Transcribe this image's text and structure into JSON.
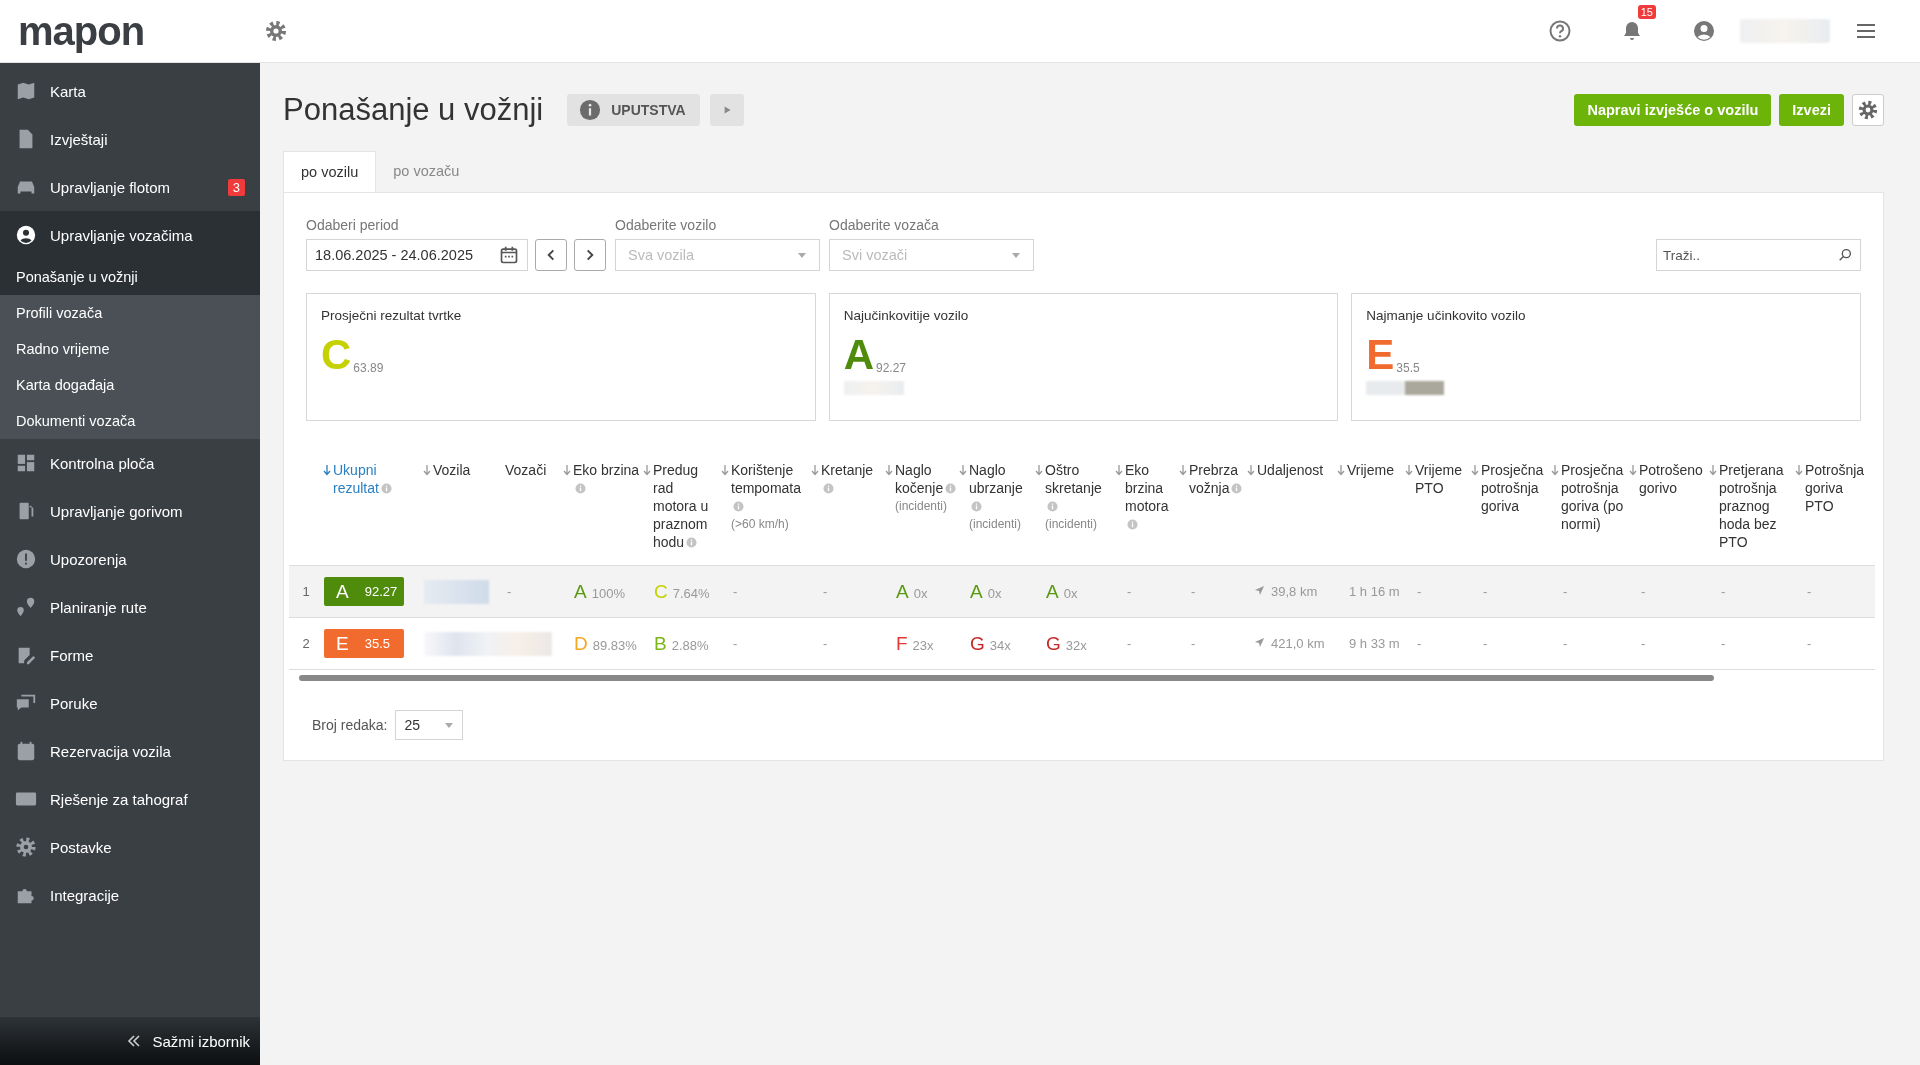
{
  "header": {
    "logo": "mapon",
    "notifications": "15"
  },
  "sidebar": {
    "items": [
      {
        "label": "Karta",
        "expanded": false
      },
      {
        "label": "Izvještaji",
        "expanded": false
      },
      {
        "label": "Upravljanje flotom",
        "badge": "3",
        "expanded": false
      },
      {
        "label": "Upravljanje vozačima",
        "expanded": true,
        "children": [
          {
            "label": "Ponašanje u vožnji",
            "selected": true
          },
          {
            "label": "Profili vozača",
            "selected": false
          },
          {
            "label": "Radno vrijeme",
            "selected": false
          },
          {
            "label": "Karta događaja",
            "selected": false
          },
          {
            "label": "Dokumenti vozača",
            "selected": false
          }
        ]
      },
      {
        "label": "Kontrolna ploča",
        "expanded": false
      },
      {
        "label": "Upravljanje gorivom",
        "expanded": false
      },
      {
        "label": "Upozorenja",
        "expanded": false
      },
      {
        "label": "Planiranje rute",
        "expanded": false
      },
      {
        "label": "Forme",
        "expanded": false
      },
      {
        "label": "Poruke",
        "expanded": false
      },
      {
        "label": "Rezervacija vozila",
        "expanded": false
      },
      {
        "label": "Rješenje za tahograf",
        "expanded": false
      },
      {
        "label": "Postavke",
        "expanded": false
      },
      {
        "label": "Integracije",
        "expanded": false
      }
    ],
    "collapse": "Sažmi izbornik"
  },
  "page": {
    "title": "Ponašanje u vožnji",
    "guide_button": "UPUTSTVA",
    "actions": [
      "Napravi izvješće o vozilu",
      "Izvezi"
    ]
  },
  "tabs": [
    {
      "label": "po vozilu",
      "selected": true
    },
    {
      "label": "po vozaču",
      "selected": false
    }
  ],
  "filters": {
    "period": {
      "label": "Odaberi period",
      "value": "18.06.2025 - 24.06.2025"
    },
    "vehicle": {
      "label": "Odaberite vozilo",
      "placeholder": "Sva vozila"
    },
    "driver": {
      "label": "Odaberite vozača",
      "placeholder": "Svi vozači"
    },
    "search": {
      "placeholder": "Traži.."
    }
  },
  "cards": [
    {
      "title": "Prosječni rezultat tvrtke",
      "grade": "C",
      "score": "63.89",
      "color": "#c5d100"
    },
    {
      "title": "Najučinkovitije vozilo",
      "grade": "A",
      "score": "92.27",
      "color": "#4f8c0c"
    },
    {
      "title": "Najmanje učinkovito vozilo",
      "grade": "E",
      "score": "35.5",
      "color": "#f26b2e"
    }
  ],
  "table": {
    "columns": [
      {
        "label": "Ukupni rezultat",
        "sortable": true,
        "info": true,
        "selected": true
      },
      {
        "label": "Vozila",
        "sortable": true,
        "info": false,
        "selected": false
      },
      {
        "label": "Vozači",
        "sortable": false,
        "info": false,
        "selected": false
      },
      {
        "label": "Eko brzina",
        "sortable": true,
        "info": true,
        "selected": false
      },
      {
        "label": "Predug rad motora u praznom hodu",
        "sortable": true,
        "info": true,
        "selected": false
      },
      {
        "label": "Korištenje tempomata",
        "note": "(>60 km/h)",
        "sortable": true,
        "info": true,
        "selected": false
      },
      {
        "label": "Kretanje",
        "sortable": true,
        "info": true,
        "selected": false
      },
      {
        "label": "Naglo kočenje",
        "note": "(incidenti)",
        "sortable": true,
        "info": true,
        "selected": false
      },
      {
        "label": "Naglo ubrzanje",
        "note": "(incidenti)",
        "sortable": true,
        "info": true,
        "selected": false
      },
      {
        "label": "Oštro skretanje",
        "note": "(incidenti)",
        "sortable": true,
        "info": true,
        "selected": false
      },
      {
        "label": "Eko brzina motora",
        "sortable": true,
        "info": true,
        "selected": false
      },
      {
        "label": "Prebrza vožnja",
        "sortable": true,
        "info": true,
        "selected": false
      },
      {
        "label": "Udaljenost",
        "sortable": true,
        "info": false,
        "selected": false
      },
      {
        "label": "Vrijeme",
        "sortable": true,
        "info": false,
        "selected": false
      },
      {
        "label": "Vrijeme PTO",
        "sortable": true,
        "info": false,
        "selected": false
      },
      {
        "label": "Prosječna potrošnja goriva",
        "sortable": true,
        "info": false,
        "selected": false
      },
      {
        "label": "Prosječna potrošnja goriva (po normi)",
        "sortable": true,
        "info": false,
        "selected": false
      },
      {
        "label": "Potrošeno gorivo",
        "sortable": true,
        "info": false,
        "selected": false
      },
      {
        "label": "Pretjerana potrošnja praznog hoda bez PTO",
        "sortable": true,
        "info": false,
        "selected": false
      },
      {
        "label": "Potrošnja goriva PTO",
        "sortable": true,
        "info": false,
        "selected": false
      }
    ],
    "rows": [
      {
        "index": "1",
        "selected": true,
        "cells": [
          {
            "kind": "score",
            "grade": "A",
            "value": "92.27",
            "color": "#4f8c0c"
          },
          {
            "kind": "redacted"
          },
          {
            "kind": "text",
            "value": "-"
          },
          {
            "kind": "grade",
            "grade": "A",
            "value": "100%",
            "color": "#5a9a12"
          },
          {
            "kind": "grade",
            "grade": "C",
            "value": "7.64%",
            "color": "#c5d100"
          },
          {
            "kind": "text",
            "value": "-"
          },
          {
            "kind": "text",
            "value": "-"
          },
          {
            "kind": "grade",
            "grade": "A",
            "value": "0x",
            "color": "#5a9a12"
          },
          {
            "kind": "grade",
            "grade": "A",
            "value": "0x",
            "color": "#5a9a12"
          },
          {
            "kind": "grade",
            "grade": "A",
            "value": "0x",
            "color": "#5a9a12"
          },
          {
            "kind": "text",
            "value": "-"
          },
          {
            "kind": "text",
            "value": "-"
          },
          {
            "kind": "distance",
            "value": "39,8 km"
          },
          {
            "kind": "text",
            "value": "1 h 16 m"
          },
          {
            "kind": "text",
            "value": "-"
          },
          {
            "kind": "text",
            "value": "-"
          },
          {
            "kind": "text",
            "value": "-"
          },
          {
            "kind": "text",
            "value": "-"
          },
          {
            "kind": "text",
            "value": "-"
          },
          {
            "kind": "text",
            "value": "-"
          }
        ]
      },
      {
        "index": "2",
        "selected": false,
        "cells": [
          {
            "kind": "score",
            "grade": "E",
            "value": "35.5",
            "color": "#f26b2e"
          },
          {
            "kind": "redacted"
          },
          {
            "kind": "empty"
          },
          {
            "kind": "grade",
            "grade": "D",
            "value": "89.83%",
            "color": "#f5a623"
          },
          {
            "kind": "grade",
            "grade": "B",
            "value": "2.88%",
            "color": "#7cb518"
          },
          {
            "kind": "text",
            "value": "-"
          },
          {
            "kind": "text",
            "value": "-"
          },
          {
            "kind": "grade",
            "grade": "F",
            "value": "23x",
            "color": "#e53935"
          },
          {
            "kind": "grade",
            "grade": "G",
            "value": "34x",
            "color": "#c62828"
          },
          {
            "kind": "grade",
            "grade": "G",
            "value": "32x",
            "color": "#c62828"
          },
          {
            "kind": "text",
            "value": "-"
          },
          {
            "kind": "text",
            "value": "-"
          },
          {
            "kind": "distance",
            "value": "421,0 km"
          },
          {
            "kind": "text",
            "value": "9 h 33 m"
          },
          {
            "kind": "text",
            "value": "-"
          },
          {
            "kind": "text",
            "value": "-"
          },
          {
            "kind": "text",
            "value": "-"
          },
          {
            "kind": "text",
            "value": "-"
          },
          {
            "kind": "text",
            "value": "-"
          },
          {
            "kind": "text",
            "value": "-"
          }
        ]
      }
    ]
  },
  "footer": {
    "label": "Broj redaka:",
    "value": "25"
  }
}
